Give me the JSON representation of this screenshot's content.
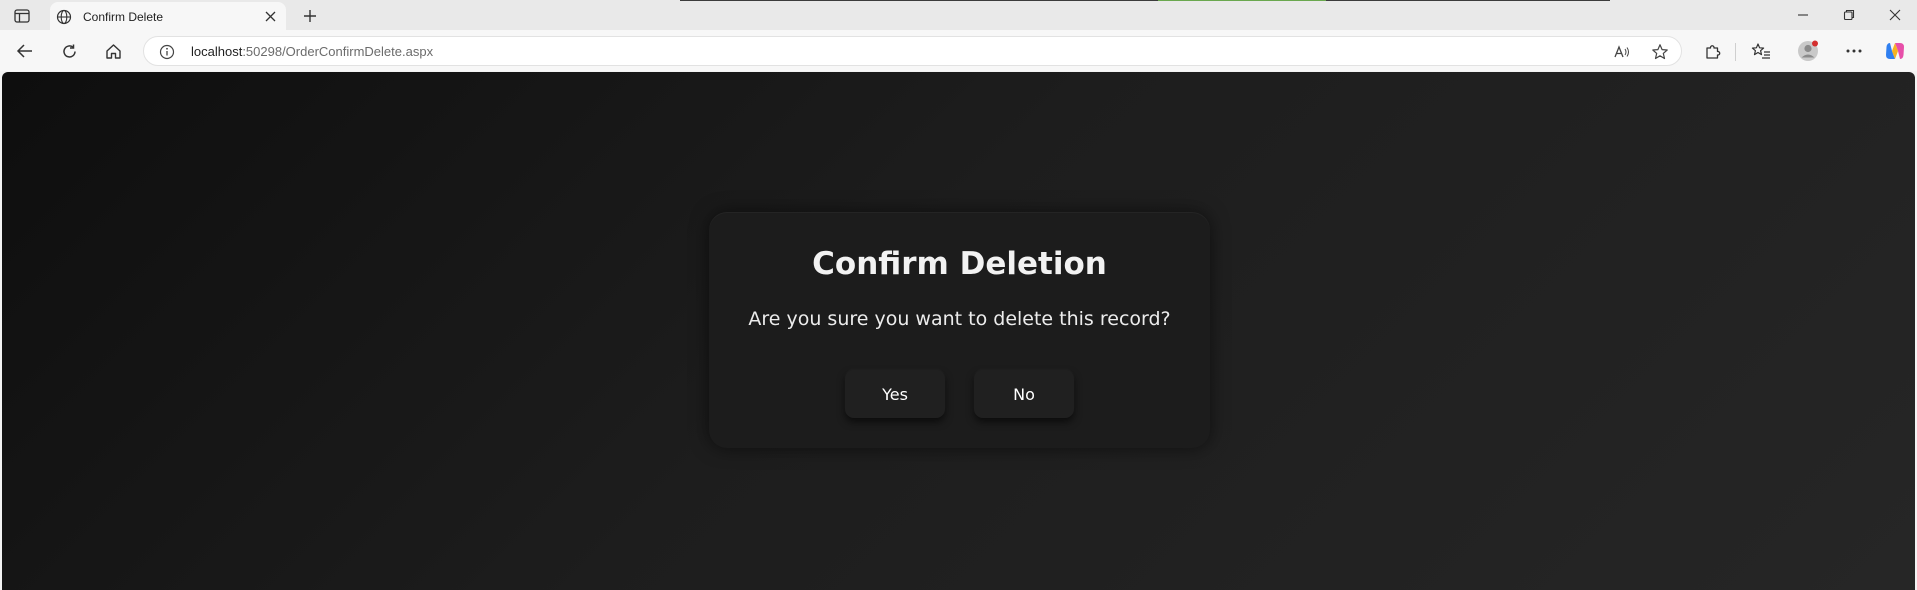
{
  "browser": {
    "tab": {
      "title": "Confirm Delete"
    },
    "address": {
      "host": "localhost",
      "path": ":50298/OrderConfirmDelete.aspx"
    }
  },
  "dialog": {
    "title": "Confirm Deletion",
    "message": "Are you sure you want to delete this record?",
    "yes_label": "Yes",
    "no_label": "No"
  },
  "colors": {
    "page_background": "#1a1a1a",
    "dialog_background": "#1c1c1c",
    "button_background": "#202020",
    "text": "#f2f2f2"
  }
}
